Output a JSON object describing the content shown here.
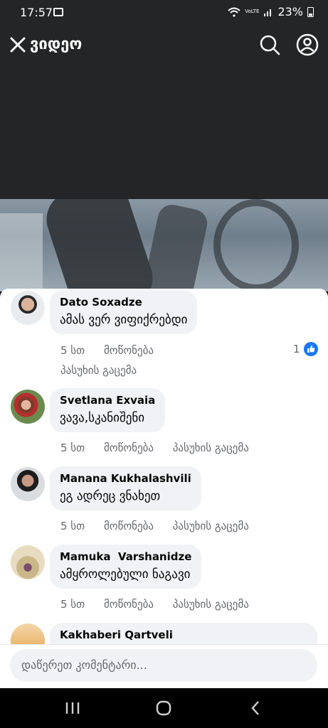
{
  "status_bar": {
    "time": "17:57",
    "network": "VoLTE",
    "battery": "23%"
  },
  "app_bar": {
    "title": "ვიდეო"
  },
  "comments": [
    {
      "name": "Dato Soxadze",
      "text": "ამას ვერ ვიფიქრებდი",
      "time": "5 სთ",
      "like_label": "მოწონება",
      "reply_label": "პასუხის გაცემა",
      "likes": "1"
    },
    {
      "name": "Svetlana Exvaia",
      "text": "ვავა,სკანიშენი",
      "time": "5 სთ",
      "like_label": "მოწონება",
      "reply_label": "პასუხის გაცემა"
    },
    {
      "name": "Manana Kukhalashvili",
      "text": "ეგ ადრეც ვნახეთ",
      "time": "5 სთ",
      "like_label": "მოწონება",
      "reply_label": "პასუხის გაცემა"
    },
    {
      "name": "Mamuka  Varshanidze",
      "text": "ამყროლებული ნაგავი",
      "time": "5 სთ",
      "like_label": "მოწონება",
      "reply_label": "პასუხის გაცემა"
    },
    {
      "name": "Kakhaberi Qartveli"
    }
  ],
  "comment_input": {
    "placeholder": "დაწერეთ კომენტარი..."
  },
  "colors": {
    "bar_bg": "#242526",
    "bubble_bg": "#f0f2f5",
    "like_blue": "#1877f2",
    "meta_gray": "#65676b"
  },
  "icons": [
    "close-icon",
    "search-icon",
    "account-icon",
    "like-icon",
    "recents-icon",
    "home-icon",
    "back-icon"
  ]
}
